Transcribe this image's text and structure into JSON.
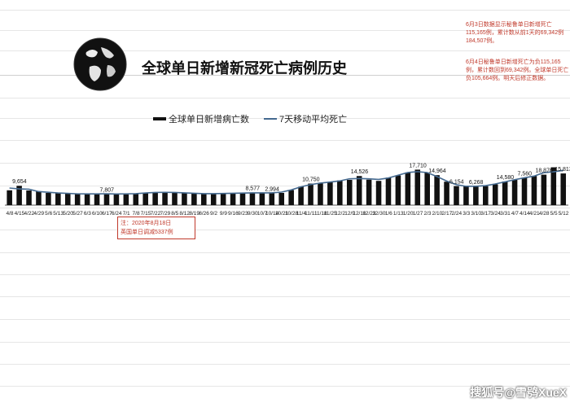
{
  "title": "全球单日新增新冠死亡病例历史",
  "legend": {
    "bar_label": "全球单日新增病亡数",
    "line_label": "7天移动平均死亡"
  },
  "notes": {
    "note1": "6月3日数据显示秘鲁单日新增死亡115,165例，累计数从前1天的69,342例184,507例。",
    "note2": "6月4日秘鲁单日新增死亡为负115,165例，累计数回到69,342例。全球单日死亡负105,664例。明天后修正数据。"
  },
  "callout": {
    "line1": "注：2020年8月18日",
    "line2": "英国单日调减5337例"
  },
  "watermark": "搜狐号@雪鸮XueX",
  "colors": {
    "bar": "#111111",
    "line": "#44698f",
    "note": "#c0392b"
  },
  "icons": {
    "globe": "globe-icon"
  },
  "chart_data": {
    "type": "bar",
    "ylim": [
      0,
      26000
    ],
    "grid": true,
    "legend_position": "top",
    "series": [
      {
        "name": "全球单日新增病亡数",
        "kind": "bar"
      },
      {
        "name": "7天移动平均死亡",
        "kind": "line"
      }
    ],
    "x": [
      "4/8",
      "4/15",
      "4/22",
      "4/29",
      "5/6",
      "5/13",
      "5/20",
      "5/27",
      "6/3",
      "6/10",
      "6/17",
      "6/24",
      "7/1",
      "7/8",
      "7/15",
      "7/22",
      "7/29",
      "8/5",
      "8/12",
      "8/19",
      "8/26",
      "9/2",
      "9/9",
      "9/16",
      "9/23",
      "9/30",
      "10/7",
      "10/14",
      "10/21",
      "10/28",
      "11/4",
      "11/11",
      "11/18",
      "11/25",
      "12/2",
      "12/9",
      "12/16",
      "12/23",
      "12/30",
      "1/6",
      "1/13",
      "1/20",
      "1/27",
      "2/3",
      "2/10",
      "2/17",
      "2/24",
      "3/3",
      "3/10",
      "3/17",
      "3/24",
      "3/31",
      "4/7",
      "4/14",
      "4/21",
      "4/28",
      "5/5",
      "5/12"
    ],
    "values": [
      7400,
      9654,
      7300,
      6900,
      6100,
      6300,
      5800,
      5500,
      5600,
      5700,
      5500,
      5800,
      5400,
      5700,
      6100,
      6400,
      6500,
      6300,
      6200,
      5900,
      5700,
      5600,
      5900,
      6000,
      5900,
      6200,
      6300,
      5900,
      6100,
      7500,
      9200,
      10750,
      10800,
      11400,
      12300,
      12600,
      14526,
      12700,
      12100,
      13700,
      14800,
      16300,
      17710,
      16100,
      14964,
      11700,
      9500,
      9400,
      9300,
      9500,
      10400,
      11800,
      12600,
      13700,
      14580,
      15200,
      18876,
      15813
    ],
    "data_labels": [
      {
        "x": "4/15",
        "value": "9,654"
      },
      {
        "x": "6/17",
        "value": "7,807"
      },
      {
        "x": "9/30",
        "value": "8,577"
      },
      {
        "x": "10/14",
        "value": "2,994"
      },
      {
        "x": "11/11",
        "value": "10,750"
      },
      {
        "x": "12/16",
        "value": "14,526"
      },
      {
        "x": "1/27",
        "value": "17,710"
      },
      {
        "x": "2/10",
        "value": "14,964"
      },
      {
        "x": "2/24",
        "value": "6,154"
      },
      {
        "x": "3/10",
        "value": "6,268"
      },
      {
        "x": "3/31",
        "value": "14,580"
      },
      {
        "x": "4/14",
        "value": "7,560"
      },
      {
        "x": "4/28",
        "value": "18,876"
      },
      {
        "x": "5/12",
        "value": "15,813"
      }
    ]
  }
}
